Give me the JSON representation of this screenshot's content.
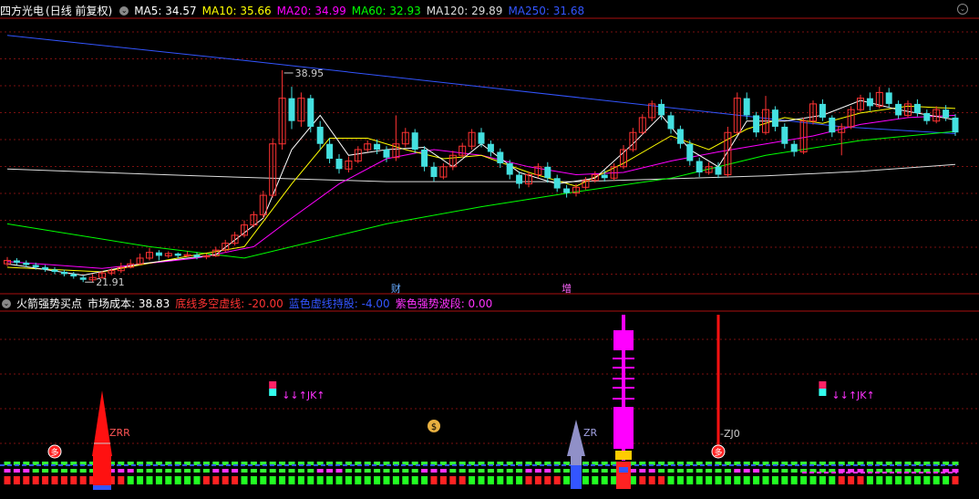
{
  "top_header": {
    "stock": "四方光电",
    "mode": "(日线 前复权)",
    "ma_items": [
      {
        "label": "MA5:",
        "value": "34.57",
        "color": "#ffffff"
      },
      {
        "label": "MA10:",
        "value": "35.66",
        "color": "#ffff00"
      },
      {
        "label": "MA20:",
        "value": "34.99",
        "color": "#ff00ff"
      },
      {
        "label": "MA60:",
        "value": "32.93",
        "color": "#00ff00"
      },
      {
        "label": "MA120:",
        "value": "29.89",
        "color": "#dddddd"
      },
      {
        "label": "MA250:",
        "value": "31.68",
        "color": "#3355ff"
      }
    ]
  },
  "bottom_header": {
    "title": "火箭强势买点",
    "items": [
      {
        "label": "市场成本:",
        "value": "38.83",
        "color": "#ffffff"
      },
      {
        "label": "底线多空虚线:",
        "value": "-20.00",
        "color": "#ff3333"
      },
      {
        "label": "蓝色虚线持股:",
        "value": "-4.00",
        "color": "#3355ff"
      },
      {
        "label": "紫色强势波段:",
        "value": "0.00",
        "color": "#ff33ff"
      }
    ]
  },
  "chart_data": {
    "type": "candlestick",
    "high_label": "38.95",
    "low_label": "21.91",
    "event_markers": [
      {
        "index": 41,
        "text": "财"
      },
      {
        "index": 59,
        "text": "增"
      }
    ],
    "candles": [
      [
        22.0,
        22.3,
        22.6,
        21.8
      ],
      [
        22.3,
        22.1,
        22.5,
        21.9
      ],
      [
        22.1,
        21.9,
        22.3,
        21.7
      ],
      [
        21.9,
        21.7,
        22.1,
        21.5
      ],
      [
        21.7,
        21.5,
        21.9,
        21.3
      ],
      [
        21.5,
        21.3,
        21.7,
        21.1
      ],
      [
        21.3,
        21.1,
        21.5,
        20.9
      ],
      [
        21.1,
        20.9,
        21.3,
        20.7
      ],
      [
        20.8,
        20.6,
        21.0,
        20.4
      ],
      [
        20.6,
        20.8,
        21.1,
        20.4
      ],
      [
        20.8,
        21.2,
        21.4,
        20.7
      ],
      [
        21.2,
        21.4,
        21.6,
        21.0
      ],
      [
        21.4,
        21.7,
        22.1,
        21.2
      ],
      [
        21.7,
        22.0,
        22.4,
        21.6
      ],
      [
        22.0,
        22.5,
        22.9,
        21.9
      ],
      [
        22.5,
        23.0,
        23.4,
        22.3
      ],
      [
        23.0,
        22.7,
        23.2,
        22.3
      ],
      [
        22.7,
        22.9,
        23.1,
        22.5
      ],
      [
        22.9,
        22.7,
        23.0,
        22.5
      ],
      [
        22.7,
        22.8,
        23.1,
        22.6
      ],
      [
        22.8,
        22.6,
        23.0,
        22.4
      ],
      [
        22.6,
        22.7,
        22.9,
        22.4
      ],
      [
        22.7,
        23.2,
        23.5,
        22.6
      ],
      [
        23.2,
        23.8,
        24.1,
        23.0
      ],
      [
        23.8,
        24.5,
        24.8,
        23.6
      ],
      [
        24.5,
        25.4,
        25.8,
        24.3
      ],
      [
        25.4,
        26.3,
        26.6,
        25.2
      ],
      [
        26.3,
        28.0,
        28.4,
        26.0
      ],
      [
        28.0,
        32.5,
        33.0,
        27.8
      ],
      [
        32.5,
        36.5,
        38.95,
        32.0
      ],
      [
        36.5,
        34.5,
        37.5,
        33.8
      ],
      [
        34.5,
        36.5,
        37.0,
        34.0
      ],
      [
        36.5,
        34.0,
        36.8,
        33.5
      ],
      [
        34.0,
        32.5,
        34.5,
        32.0
      ],
      [
        32.5,
        31.2,
        33.0,
        30.8
      ],
      [
        31.2,
        30.3,
        31.6,
        29.9
      ],
      [
        30.3,
        31.0,
        31.4,
        30.0
      ],
      [
        31.0,
        32.0,
        32.3,
        30.8
      ],
      [
        32.0,
        32.5,
        32.8,
        31.8
      ],
      [
        32.5,
        32.0,
        32.9,
        31.6
      ],
      [
        32.0,
        31.3,
        32.3,
        30.9
      ],
      [
        31.3,
        32.5,
        35.0,
        31.0
      ],
      [
        32.5,
        33.5,
        33.9,
        32.2
      ],
      [
        33.5,
        32.0,
        33.8,
        31.7
      ],
      [
        32.0,
        30.5,
        32.3,
        30.1
      ],
      [
        30.5,
        29.6,
        30.9,
        29.2
      ],
      [
        29.6,
        30.5,
        30.8,
        29.4
      ],
      [
        30.5,
        31.5,
        31.9,
        30.2
      ],
      [
        31.5,
        32.3,
        32.6,
        31.3
      ],
      [
        32.3,
        33.5,
        33.8,
        32.0
      ],
      [
        33.5,
        32.5,
        33.9,
        32.2
      ],
      [
        32.5,
        31.8,
        32.8,
        31.4
      ],
      [
        31.8,
        30.8,
        32.1,
        30.4
      ],
      [
        30.8,
        29.8,
        31.1,
        29.4
      ],
      [
        29.8,
        29.0,
        30.1,
        28.6
      ],
      [
        29.0,
        29.8,
        30.1,
        28.7
      ],
      [
        29.8,
        30.5,
        30.8,
        29.5
      ],
      [
        30.5,
        29.5,
        30.9,
        29.1
      ],
      [
        29.5,
        28.6,
        29.8,
        28.3
      ],
      [
        28.6,
        28.2,
        28.9,
        27.8
      ],
      [
        28.2,
        28.7,
        29.0,
        27.9
      ],
      [
        28.7,
        29.3,
        29.6,
        28.5
      ],
      [
        29.3,
        29.8,
        30.1,
        29.1
      ],
      [
        29.8,
        29.5,
        30.2,
        29.2
      ],
      [
        29.5,
        30.5,
        30.8,
        29.3
      ],
      [
        30.5,
        32.0,
        32.4,
        30.3
      ],
      [
        32.0,
        33.5,
        33.9,
        31.8
      ],
      [
        33.5,
        34.8,
        35.1,
        33.3
      ],
      [
        34.8,
        36.0,
        36.3,
        34.5
      ],
      [
        36.0,
        35.0,
        36.4,
        34.6
      ],
      [
        35.0,
        33.8,
        35.3,
        33.4
      ],
      [
        33.8,
        32.5,
        34.1,
        32.1
      ],
      [
        32.5,
        31.0,
        32.8,
        30.6
      ],
      [
        31.0,
        30.0,
        31.3,
        29.6
      ],
      [
        30.0,
        30.5,
        30.9,
        29.8
      ],
      [
        30.5,
        29.8,
        30.9,
        29.5
      ],
      [
        29.8,
        33.5,
        34.0,
        29.6
      ],
      [
        33.5,
        36.5,
        37.0,
        33.3
      ],
      [
        36.5,
        35.0,
        37.0,
        34.6
      ],
      [
        35.0,
        33.5,
        35.3,
        33.1
      ],
      [
        33.5,
        35.5,
        36.7,
        33.3
      ],
      [
        35.5,
        34.0,
        35.8,
        33.6
      ],
      [
        34.0,
        32.5,
        34.3,
        32.1
      ],
      [
        32.5,
        31.8,
        32.8,
        31.4
      ],
      [
        31.8,
        34.5,
        34.8,
        31.6
      ],
      [
        34.5,
        36.0,
        36.3,
        34.2
      ],
      [
        36.0,
        34.8,
        36.4,
        34.5
      ],
      [
        34.8,
        33.5,
        35.0,
        33.1
      ],
      [
        33.5,
        34.0,
        34.3,
        31.5
      ],
      [
        34.0,
        35.5,
        35.8,
        33.8
      ],
      [
        35.5,
        36.5,
        36.8,
        35.3
      ],
      [
        36.5,
        35.8,
        37.0,
        35.4
      ],
      [
        35.8,
        37.0,
        37.5,
        35.6
      ],
      [
        37.0,
        36.0,
        37.4,
        35.7
      ],
      [
        36.0,
        35.0,
        36.3,
        34.7
      ],
      [
        35.0,
        36.0,
        36.3,
        34.8
      ],
      [
        36.0,
        35.2,
        36.4,
        34.9
      ],
      [
        35.2,
        34.5,
        35.5,
        34.2
      ],
      [
        34.5,
        35.5,
        35.8,
        34.3
      ],
      [
        35.5,
        34.8,
        35.9,
        34.5
      ],
      [
        34.8,
        33.5,
        35.1,
        33.2
      ]
    ],
    "ma_lines": {
      "MA250": [
        [
          0,
          42.0
        ],
        [
          25,
          39.8
        ],
        [
          50,
          37.5
        ],
        [
          75,
          35.2
        ],
        [
          88,
          34.0
        ],
        [
          100,
          33.4
        ]
      ],
      "MA120": [
        [
          0,
          30.3
        ],
        [
          20,
          29.7
        ],
        [
          40,
          29.2
        ],
        [
          60,
          29.2
        ],
        [
          80,
          29.7
        ],
        [
          90,
          30.1
        ],
        [
          100,
          30.7
        ]
      ],
      "MA60": [
        [
          0,
          25.5
        ],
        [
          15,
          23.5
        ],
        [
          25,
          22.5
        ],
        [
          40,
          25.5
        ],
        [
          50,
          27.0
        ],
        [
          60,
          28.3
        ],
        [
          70,
          29.5
        ],
        [
          80,
          31.5
        ],
        [
          90,
          32.8
        ],
        [
          100,
          33.6
        ]
      ],
      "MA20": [
        [
          0,
          22.2
        ],
        [
          10,
          21.6
        ],
        [
          20,
          22.5
        ],
        [
          26,
          23.5
        ],
        [
          30,
          26.0
        ],
        [
          35,
          29.0
        ],
        [
          40,
          31.2
        ],
        [
          45,
          32.0
        ],
        [
          50,
          31.5
        ],
        [
          55,
          30.5
        ],
        [
          60,
          29.8
        ],
        [
          65,
          30.0
        ],
        [
          70,
          31.0
        ],
        [
          75,
          31.8
        ],
        [
          80,
          32.5
        ],
        [
          85,
          33.2
        ],
        [
          90,
          34.2
        ],
        [
          95,
          34.8
        ],
        [
          100,
          35.0
        ]
      ],
      "MA10": [
        [
          0,
          21.7
        ],
        [
          10,
          21.3
        ],
        [
          18,
          22.5
        ],
        [
          25,
          23.5
        ],
        [
          30,
          29.0
        ],
        [
          34,
          33.0
        ],
        [
          38,
          33.0
        ],
        [
          42,
          32.0
        ],
        [
          46,
          31.2
        ],
        [
          50,
          31.5
        ],
        [
          55,
          30.0
        ],
        [
          60,
          28.8
        ],
        [
          65,
          30.8
        ],
        [
          70,
          33.2
        ],
        [
          74,
          32.0
        ],
        [
          78,
          33.8
        ],
        [
          82,
          34.8
        ],
        [
          86,
          34.3
        ],
        [
          90,
          35.2
        ],
        [
          95,
          35.8
        ],
        [
          100,
          35.6
        ]
      ],
      "MA5": [
        [
          0,
          22.0
        ],
        [
          8,
          21.0
        ],
        [
          14,
          22.0
        ],
        [
          22,
          22.8
        ],
        [
          27,
          26.0
        ],
        [
          30,
          32.0
        ],
        [
          33,
          35.0
        ],
        [
          36,
          31.5
        ],
        [
          40,
          32.0
        ],
        [
          44,
          32.2
        ],
        [
          47,
          30.5
        ],
        [
          50,
          32.5
        ],
        [
          54,
          30.0
        ],
        [
          58,
          29.0
        ],
        [
          62,
          29.5
        ],
        [
          66,
          32.5
        ],
        [
          69,
          35.0
        ],
        [
          72,
          32.0
        ],
        [
          75,
          30.5
        ],
        [
          78,
          34.5
        ],
        [
          82,
          34.5
        ],
        [
          86,
          35.0
        ],
        [
          90,
          36.3
        ],
        [
          94,
          35.5
        ],
        [
          100,
          34.6
        ]
      ]
    },
    "price_min": 19.7,
    "price_max": 43.5
  },
  "indicator": {
    "signals": [
      {
        "type": "red_rocket",
        "index": 10,
        "label": "ZRR"
      },
      {
        "type": "grey_rocket",
        "index": 60,
        "label": "ZR"
      },
      {
        "type": "magenta_tower",
        "index": 65
      },
      {
        "type": "red_spike",
        "index": 75,
        "label": "ZJ0"
      }
    ],
    "jk_markers": [
      {
        "index": 28,
        "text": "JK"
      },
      {
        "index": 86,
        "text": "JK"
      }
    ],
    "duo_markers": [
      {
        "index": 5,
        "text": "多"
      },
      {
        "index": 75,
        "text": "多"
      }
    ],
    "money_markers": [
      {
        "index": 45,
        "text": "$"
      }
    ],
    "row_pattern_bottom": "RRRRRRRRRRRRRGGGGGGGGRRRRGGGGGGGGGGGGGGGGGGGGRRRRGGGGGGRRRRGGGGGGGGRRRGGGGGGGGGGGGGGGGGGRRRGGGGGGGGGRRG"
  }
}
